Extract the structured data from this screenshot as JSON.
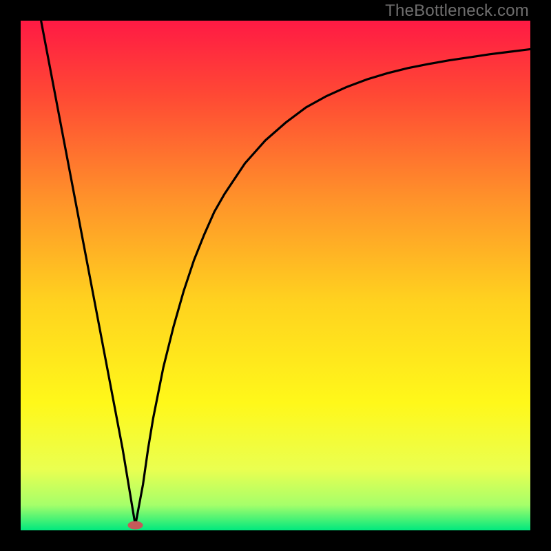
{
  "watermark": "TheBottleneck.com",
  "chart_data": {
    "type": "line",
    "title": "",
    "xlabel": "",
    "ylabel": "",
    "xlim": [
      0,
      100
    ],
    "ylim": [
      0,
      100
    ],
    "grid": false,
    "legend": false,
    "background_gradient": {
      "stops": [
        {
          "offset": 0.0,
          "color": "#ff1a44"
        },
        {
          "offset": 0.15,
          "color": "#ff4a34"
        },
        {
          "offset": 0.35,
          "color": "#ff922a"
        },
        {
          "offset": 0.55,
          "color": "#ffd21f"
        },
        {
          "offset": 0.75,
          "color": "#fff81a"
        },
        {
          "offset": 0.88,
          "color": "#eaff50"
        },
        {
          "offset": 0.95,
          "color": "#a6ff6a"
        },
        {
          "offset": 1.0,
          "color": "#00e87e"
        }
      ]
    },
    "marker": {
      "x": 22.5,
      "y": 1.0,
      "color": "#c55a5a"
    },
    "series": [
      {
        "name": "curve",
        "x": [
          4.0,
          6,
          8,
          10,
          12,
          14,
          16,
          18,
          20,
          21,
          22.5,
          24,
          25,
          26,
          27,
          28,
          30,
          32,
          34,
          36,
          38,
          40,
          44,
          48,
          52,
          56,
          60,
          64,
          68,
          72,
          76,
          80,
          84,
          88,
          92,
          96,
          100
        ],
        "y": [
          100,
          89.5,
          79,
          68.5,
          58,
          47.5,
          37,
          26.5,
          16,
          10,
          1.0,
          9,
          16,
          22,
          27,
          32,
          40,
          47,
          53,
          58,
          62.5,
          66,
          72,
          76.5,
          80,
          83,
          85.2,
          87,
          88.5,
          89.7,
          90.7,
          91.5,
          92.2,
          92.8,
          93.4,
          93.9,
          94.4
        ]
      }
    ]
  }
}
